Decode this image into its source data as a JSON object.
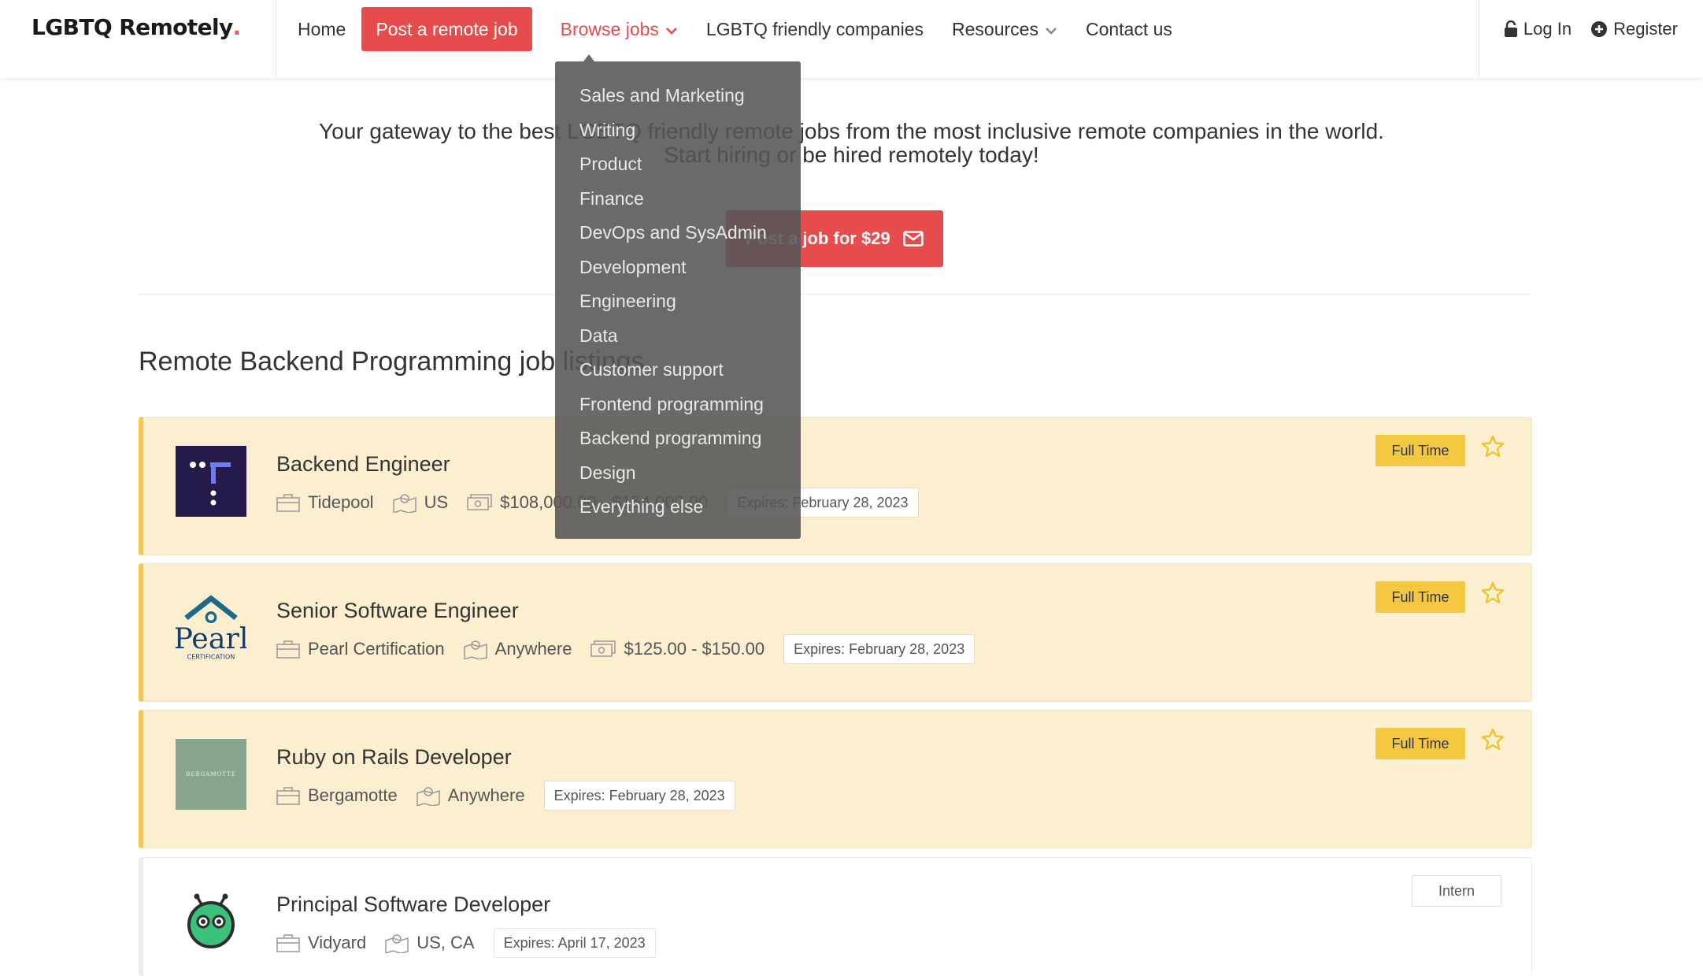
{
  "brand": {
    "name": "LGBTQ Remotely",
    "dot": ".",
    "accent": "#e74c4c",
    "featured_bg": "#fcefd0",
    "badge_color": "#f5c842"
  },
  "nav": {
    "home": "Home",
    "post_job": "Post a remote job",
    "browse_jobs": "Browse jobs",
    "companies": "LGBTQ friendly companies",
    "resources": "Resources",
    "contact": "Contact us",
    "login": "Log In",
    "register": "Register"
  },
  "dropdown": {
    "items": [
      "Sales and Marketing",
      "Writing",
      "Product",
      "Finance",
      "DevOps and SysAdmin",
      "Development",
      "Engineering",
      "Data",
      "Customer support",
      "Frontend programming",
      "Backend programming",
      "Design",
      "Everything else"
    ]
  },
  "hero": {
    "tagline_line1": "Your gateway to the best LGBTQ friendly remote jobs from the most inclusive remote companies in the world.",
    "tagline_line2": "Start hiring or be hired remotely today!",
    "button_label": "Post a job for $29",
    "button_icon": "envelope-icon"
  },
  "listings": {
    "title": "Remote Backend Programming job listings",
    "jobs": [
      {
        "title": "Backend Engineer",
        "company": "Tidepool",
        "location": "US",
        "salary": "$108,000.00 - $154,000.00",
        "expires": "Expires: February 28, 2023",
        "type": "Full Time",
        "logo": "tidepool-logo"
      },
      {
        "title": "Senior Software Engineer",
        "company": "Pearl Certification",
        "location": "Anywhere",
        "salary": "$125.00 - $150.00",
        "expires": "Expires: February 28, 2023",
        "type": "Full Time",
        "logo": "pearl-logo",
        "logo_word": "Pearl",
        "logo_sub": "CERTIFICATION"
      },
      {
        "title": "Ruby on Rails Developer",
        "company": "Bergamotte",
        "location": "Anywhere",
        "expires": "Expires: February 28, 2023",
        "type": "Full Time",
        "logo": "bergamotte-logo",
        "logo_word": "BERGAMOTTE"
      },
      {
        "title": "Principal Software Developer",
        "company": "Vidyard",
        "location": "US, CA",
        "expires": "Expires: April 17, 2023",
        "type": "Intern",
        "logo": "vidyard-logo"
      }
    ]
  }
}
